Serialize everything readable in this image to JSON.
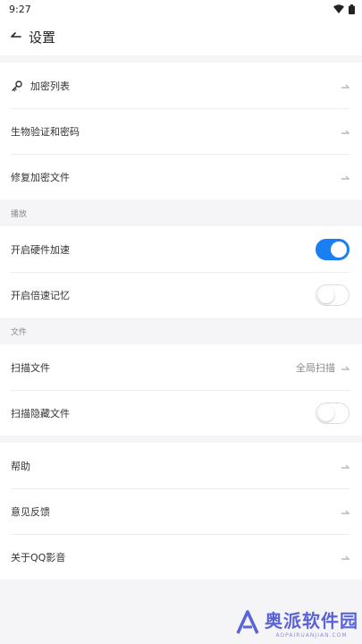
{
  "status_bar": {
    "time": "9:27"
  },
  "header": {
    "title": "设置"
  },
  "groups": {
    "top": [
      {
        "label": "加密列表"
      },
      {
        "label": "生物验证和密码"
      },
      {
        "label": "修复加密文件"
      }
    ],
    "playback": {
      "section_label": "播放",
      "items": [
        {
          "label": "开启硬件加速",
          "toggle_on": true
        },
        {
          "label": "开启倍速记忆",
          "toggle_on": false
        }
      ]
    },
    "files": {
      "section_label": "文件",
      "items": [
        {
          "label": "扫描文件",
          "value": "全局扫描"
        },
        {
          "label": "扫描隐藏文件",
          "toggle_on": false
        }
      ]
    },
    "about": [
      {
        "label": "帮助"
      },
      {
        "label": "意见反馈"
      },
      {
        "label": "关于QQ影音"
      }
    ]
  },
  "watermark": {
    "main": "奥派软件园",
    "sub": "AOPAIRUANJIAN.COM"
  },
  "colors": {
    "accent": "#1a7ff2",
    "background": "#f5f5f7",
    "watermark": "#5a63d8"
  },
  "icons": [
    "wifi-icon",
    "battery-icon",
    "back-arrow-icon",
    "key-icon",
    "arrow-icon"
  ]
}
